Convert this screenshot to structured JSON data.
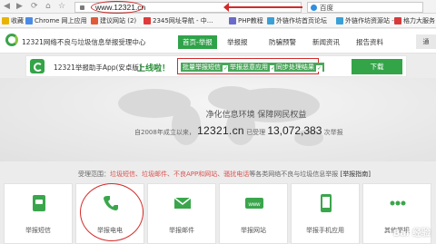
{
  "browser": {
    "back": "◀",
    "forward": "▶",
    "reload": "⟳",
    "address": "www.12321.cn",
    "search_value": "百度",
    "annotation_color": "#d42a2a"
  },
  "bookmarks": [
    {
      "label": "收藏",
      "color": "#e8b400"
    },
    {
      "label": "Chrome 网上应用",
      "color": "#4a8be8"
    },
    {
      "label": "建议网站 (2)",
      "color": "#e05a3a"
    },
    {
      "label": "2345网址导航 - 中...",
      "color": "#e03a3a"
    },
    {
      "label": "PHP教程",
      "color": "#6a6acc"
    },
    {
      "label": "外链作坊首页论坛",
      "color": "#3aa0d8"
    },
    {
      "label": "外链作坊资源站 -",
      "color": "#3aa0d8"
    },
    {
      "label": "格力大服务",
      "color": "#d63a3a"
    }
  ],
  "site": {
    "title": "12321网络不良与垃圾信息举报受理中心",
    "accent_color": "#30a34a",
    "nav": [
      "首页-举报",
      "举报报",
      "防骗预警",
      "新闻资讯",
      "报告资料"
    ],
    "right_tool": "通"
  },
  "app_banner": {
    "text": "12321举报助手App(安卓版)",
    "online": "上线啦！",
    "features": [
      "批量举报短信",
      "举报恶意应用",
      "同步处理结果"
    ],
    "download": "下载"
  },
  "hero": {
    "slogan": "净化信息环境  保障网民权益",
    "stats_prefix": "自2008年成立以来，",
    "domain": "12321.cn",
    "stats_middle": " 已受理 ",
    "count": "13,072,383",
    "stats_suffix": " 次举报"
  },
  "scope": {
    "label": "受理范围：",
    "items": "垃圾短信、垃圾邮件、不良APP和网站、骚扰电话",
    "tail": "等各类网络不良与垃圾信息举报",
    "guide": "[举报指南]"
  },
  "cards": [
    {
      "label": "举报短信",
      "icon": "sms-icon"
    },
    {
      "label": "举报电电",
      "icon": "phone-icon"
    },
    {
      "label": "举报邮件",
      "icon": "mail-icon"
    },
    {
      "label": "举报网站",
      "icon": "www-icon"
    },
    {
      "label": "举报手机应用",
      "icon": "app-icon"
    },
    {
      "label": "其他举报",
      "icon": "other-icon"
    }
  ],
  "watermark": "Bai 经验"
}
